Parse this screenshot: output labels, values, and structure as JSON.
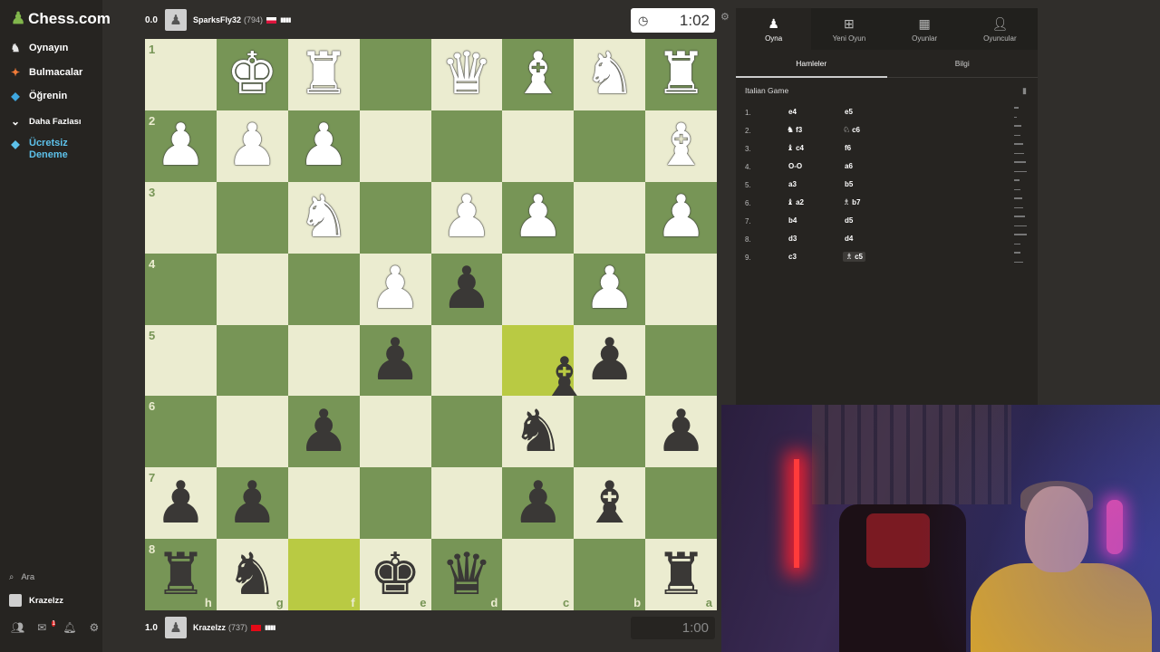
{
  "sidebar": {
    "logo": "Chess.com",
    "nav": [
      {
        "label": "Oynayın",
        "icon": "play-icon"
      },
      {
        "label": "Bulmacalar",
        "icon": "puzzle-icon"
      },
      {
        "label": "Öğrenin",
        "icon": "learn-icon"
      },
      {
        "label": "Daha Fazlası",
        "icon": "chevron-down-icon"
      }
    ],
    "trial": {
      "line1": "Ücretsiz",
      "line2": "Deneme",
      "icon": "diamond-icon"
    },
    "search_label": "Ara",
    "user_label": "Krazelzz",
    "notification_count": "1"
  },
  "top_player": {
    "score": "0.0",
    "name": "SparksFly32",
    "rating": "(794)",
    "clock": "1:02",
    "flag_colors": [
      "#ffffff",
      "#dc143c"
    ]
  },
  "bottom_player": {
    "score": "1.0",
    "name": "Krazelzz",
    "rating": "(737)",
    "clock": "1:00",
    "flag_color": "#e30a17"
  },
  "board": {
    "ranks": [
      "1",
      "2",
      "3",
      "4",
      "5",
      "6",
      "7",
      "8"
    ],
    "files": [
      "h",
      "g",
      "f",
      "e",
      "d",
      "c",
      "b",
      "a"
    ],
    "rows": [
      [
        "",
        "wK",
        "wR",
        "",
        "wQ",
        "wB",
        "wN",
        "wR"
      ],
      [
        "wP",
        "wP",
        "wP",
        "",
        "",
        "",
        "",
        "wB"
      ],
      [
        "",
        "",
        "wN",
        "",
        "wP",
        "wP",
        "",
        "wP"
      ],
      [
        "",
        "",
        "",
        "wP",
        "bP",
        "",
        "wP",
        ""
      ],
      [
        "",
        "",
        "",
        "bP",
        "",
        "",
        "bP",
        ""
      ],
      [
        "",
        "",
        "bP",
        "",
        "",
        "bN",
        "",
        "bP"
      ],
      [
        "bP",
        "bP",
        "",
        "",
        "",
        "bP",
        "bB",
        ""
      ],
      [
        "bR",
        "bN",
        "",
        "bK",
        "bQ",
        "",
        "",
        "bR"
      ]
    ],
    "highlights": [
      "4-5",
      "7-2"
    ],
    "dragging_piece": "bB",
    "colors": {
      "light": "#ebecd0",
      "dark": "#779556",
      "highlight": "#b9ca43"
    }
  },
  "panel": {
    "tabs": [
      {
        "label": "Oyna",
        "icon": "pawn-icon"
      },
      {
        "label": "Yeni Oyun",
        "icon": "plus-icon"
      },
      {
        "label": "Oyunlar",
        "icon": "board-icon"
      },
      {
        "label": "Oyuncular",
        "icon": "players-icon"
      }
    ],
    "subtabs": [
      "Hamleler",
      "Bilgi"
    ],
    "opening": "Italian Game",
    "moves": [
      {
        "n": "1.",
        "w": "e4",
        "wp": "",
        "b": "e5",
        "bp": ""
      },
      {
        "n": "2.",
        "w": "f3",
        "wp": "♞",
        "b": "c6",
        "bp": "♘"
      },
      {
        "n": "3.",
        "w": "c4",
        "wp": "♝",
        "b": "f6",
        "bp": ""
      },
      {
        "n": "4.",
        "w": "O-O",
        "wp": "",
        "b": "a6",
        "bp": ""
      },
      {
        "n": "5.",
        "w": "a3",
        "wp": "",
        "b": "b5",
        "bp": ""
      },
      {
        "n": "6.",
        "w": "a2",
        "wp": "♝",
        "b": "b7",
        "bp": "♗"
      },
      {
        "n": "7.",
        "w": "b4",
        "wp": "",
        "b": "d5",
        "bp": ""
      },
      {
        "n": "8.",
        "w": "d3",
        "wp": "",
        "b": "d4",
        "bp": ""
      },
      {
        "n": "9.",
        "w": "c3",
        "wp": "",
        "b": "c5",
        "bp": "♗"
      }
    ]
  }
}
